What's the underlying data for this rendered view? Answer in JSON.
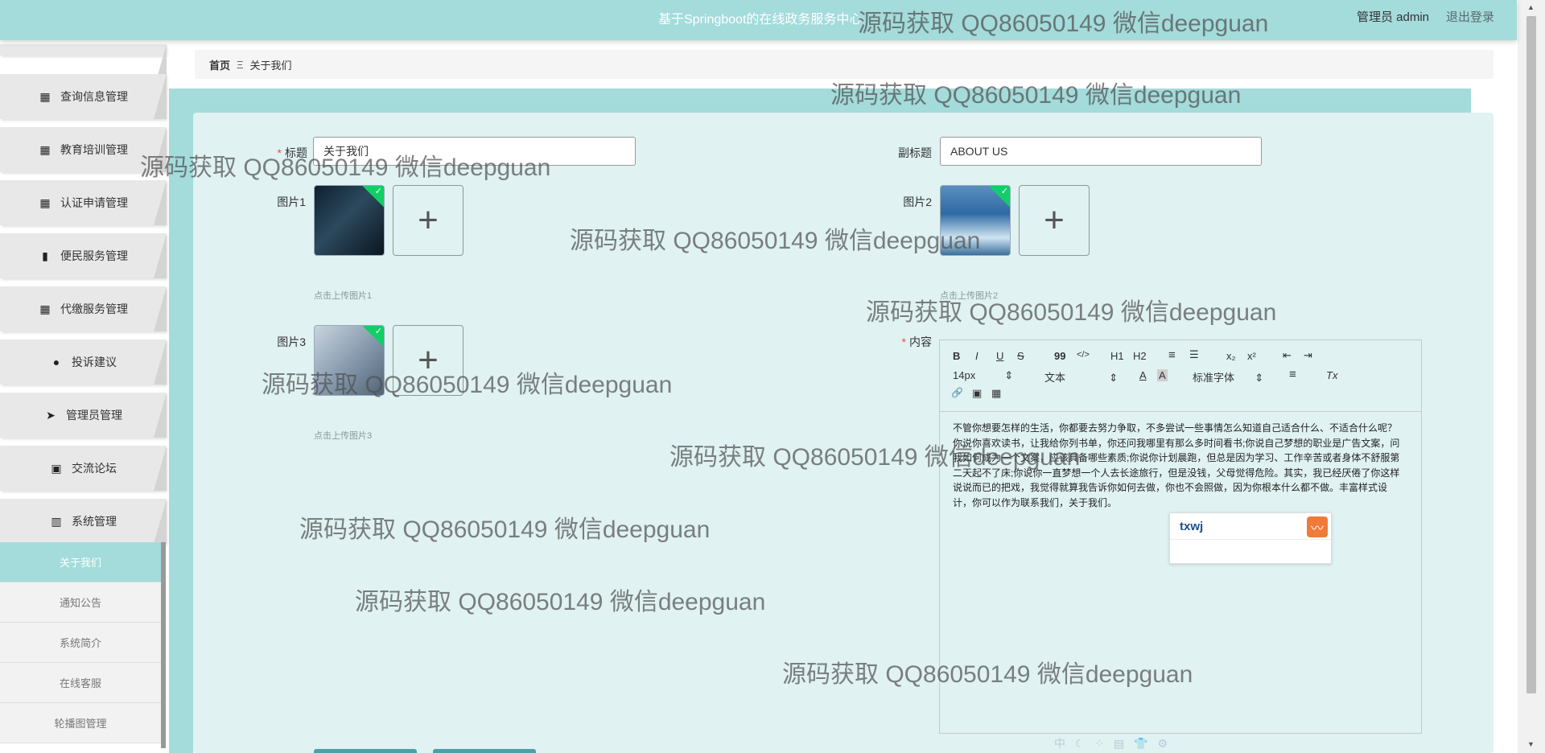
{
  "header": {
    "app_title": "基于Springboot的在线政务服务中心",
    "role_user": "管理员 admin",
    "logout": "退出登录"
  },
  "sidebar": {
    "items": [
      {
        "label": "查询信息管理",
        "icon": "grid-icon"
      },
      {
        "label": "教育培训管理",
        "icon": "grid-icon"
      },
      {
        "label": "认证申请管理",
        "icon": "grid-icon"
      },
      {
        "label": "便民服务管理",
        "icon": "bar-chart-icon"
      },
      {
        "label": "代缴服务管理",
        "icon": "grid-icon"
      },
      {
        "label": "投诉建议",
        "icon": "user-icon"
      },
      {
        "label": "管理员管理",
        "icon": "paper-plane-icon"
      },
      {
        "label": "交流论坛",
        "icon": "clipboard-icon"
      },
      {
        "label": "系统管理",
        "icon": "book-icon"
      }
    ],
    "submenu": [
      {
        "label": "关于我们",
        "active": true
      },
      {
        "label": "通知公告",
        "active": false
      },
      {
        "label": "系统简介",
        "active": false
      },
      {
        "label": "在线客服",
        "active": false
      },
      {
        "label": "轮播图管理",
        "active": false
      }
    ]
  },
  "breadcrumb": {
    "home": "首页",
    "separator": "Ξ",
    "current": "关于我们"
  },
  "form": {
    "title_label": "标题",
    "title_value": "关于我们",
    "subtitle_label": "副标题",
    "subtitle_value": "ABOUT US",
    "image1_label": "图片1",
    "image1_hint": "点击上传图片1",
    "image2_label": "图片2",
    "image2_hint": "点击上传图片2",
    "image3_label": "图片3",
    "image3_hint": "点击上传图片3",
    "add_symbol": "+",
    "content_label": "内容",
    "required_mark": "*"
  },
  "editor": {
    "toolbar": {
      "bold": "B",
      "italic": "I",
      "underline": "U",
      "strike": "S",
      "quote": "99",
      "code": "</>",
      "h1": "H1",
      "h2": "H2",
      "ordered": "≡",
      "bullet": "☰",
      "sub": "x₂",
      "sup": "x²",
      "outdent": "⇤",
      "indent": "⇥",
      "size": "14px",
      "style": "文本",
      "font_color": "A",
      "bg_color": "A",
      "font": "标准字体",
      "align": "≡",
      "clear": "Tx",
      "link": "🔗",
      "image": "▣",
      "video": "▦"
    },
    "content": "不管你想要怎样的生活，你都要去努力争取，不多尝试一些事情怎么知道自己适合什么、不适合什么呢？你说你喜欢读书，让我给你列书单，你还问我哪里有那么多时间看书;你说自己梦想的职业是广告文案，问我如何成为一个文案，应该具备哪些素质;你说你计划晨跑，但总是因为学习、工作辛苦或者身体不舒服第二天起不了床;你说你一直梦想一个人去长途旅行，但是没钱，父母觉得危险。其实，我已经厌倦了你这样说说而已的把戏，我觉得就算我告诉你如何去做，你也不会照做，因为你根本什么都不做。丰富样式设计，你可以作为联系我们，关于我们。"
  },
  "ime": {
    "text": "txwj",
    "toolbar_glyphs": "中 ☾ ⁘ ▤ 👕 ⚙"
  },
  "watermark": "源码获取 QQ86050149 微信deepguan",
  "colors": {
    "accent": "#a4dbdb",
    "card": "#e0f2f2",
    "sidebar_item": "#e8e8e8",
    "success_corner": "#13ce66"
  }
}
